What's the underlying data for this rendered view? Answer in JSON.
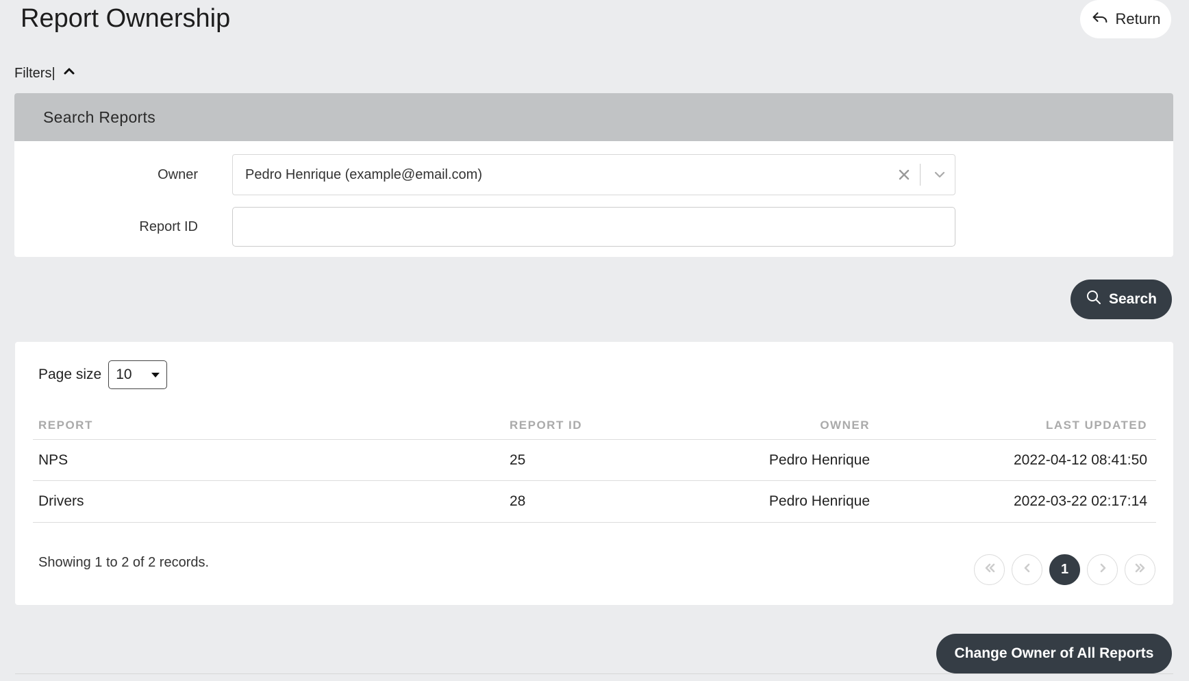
{
  "header": {
    "title": "Report Ownership",
    "return_label": "Return"
  },
  "filters": {
    "toggle_label": "Filters|",
    "panel_title": "Search Reports",
    "owner_label": "Owner",
    "owner_value": "Pedro Henrique (example@email.com)",
    "report_id_label": "Report ID",
    "report_id_value": "",
    "search_label": "Search"
  },
  "results": {
    "page_size_label": "Page size",
    "page_size_value": "10",
    "columns": [
      "REPORT",
      "REPORT ID",
      "OWNER",
      "LAST UPDATED"
    ],
    "rows": [
      {
        "report": "NPS",
        "report_id": "25",
        "owner": "Pedro Henrique",
        "last_updated": "2022-04-12 08:41:50"
      },
      {
        "report": "Drivers",
        "report_id": "28",
        "owner": "Pedro Henrique",
        "last_updated": "2022-03-22 02:17:14"
      }
    ],
    "summary": "Showing 1 to 2 of 2 records.",
    "current_page": "1"
  },
  "actions": {
    "change_owner_label": "Change Owner of All Reports"
  },
  "colors": {
    "background": "#ebecee",
    "panel_header": "#c1c3c5",
    "primary_button": "#353d45"
  },
  "icons": [
    "return-icon",
    "chevron-up-icon",
    "clear-icon",
    "chevron-down-icon",
    "search-icon",
    "first-page-icon",
    "prev-page-icon",
    "next-page-icon",
    "last-page-icon"
  ]
}
